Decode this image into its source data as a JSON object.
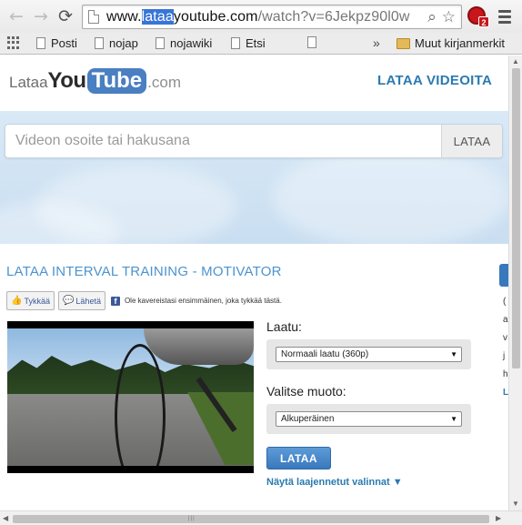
{
  "browser": {
    "url_prefix": "www.",
    "url_highlight": "lataa",
    "url_host_rest": "youtube.com",
    "url_path": "/watch?v=6Jekpz90l0w",
    "extension_badge": "2"
  },
  "bookmarks": {
    "items": [
      "Posti",
      "nojap",
      "nojawiki",
      "Etsi"
    ],
    "more": "»",
    "folder": "Muut kirjanmerkit"
  },
  "site": {
    "logo_lataa": "Lataa",
    "logo_you": "You",
    "logo_tube": "Tube",
    "logo_com": ".com",
    "header_link": "LATAA VIDEOITA"
  },
  "search": {
    "placeholder": "Videon osoite tai hakusana",
    "button": "LATAA"
  },
  "video": {
    "title": "LATAA INTERVAL TRAINING - MOTIVATOR"
  },
  "social": {
    "like": "Tykkää",
    "share": "Lähetä",
    "fb_logo": "f",
    "fb_text": "Ole kavereistasi ensimmäinen, joka tykkää tästä."
  },
  "form": {
    "quality_label": "Laatu:",
    "quality_value": "Normaali laatu (360p)",
    "format_label": "Valitse muoto:",
    "format_value": "Alkuperäinen",
    "download_button": "LATAA",
    "advanced_link": "Näytä laajennetut valinnat ▼"
  },
  "side": [
    "(",
    "a",
    "v",
    "j",
    "h",
    "L"
  ]
}
